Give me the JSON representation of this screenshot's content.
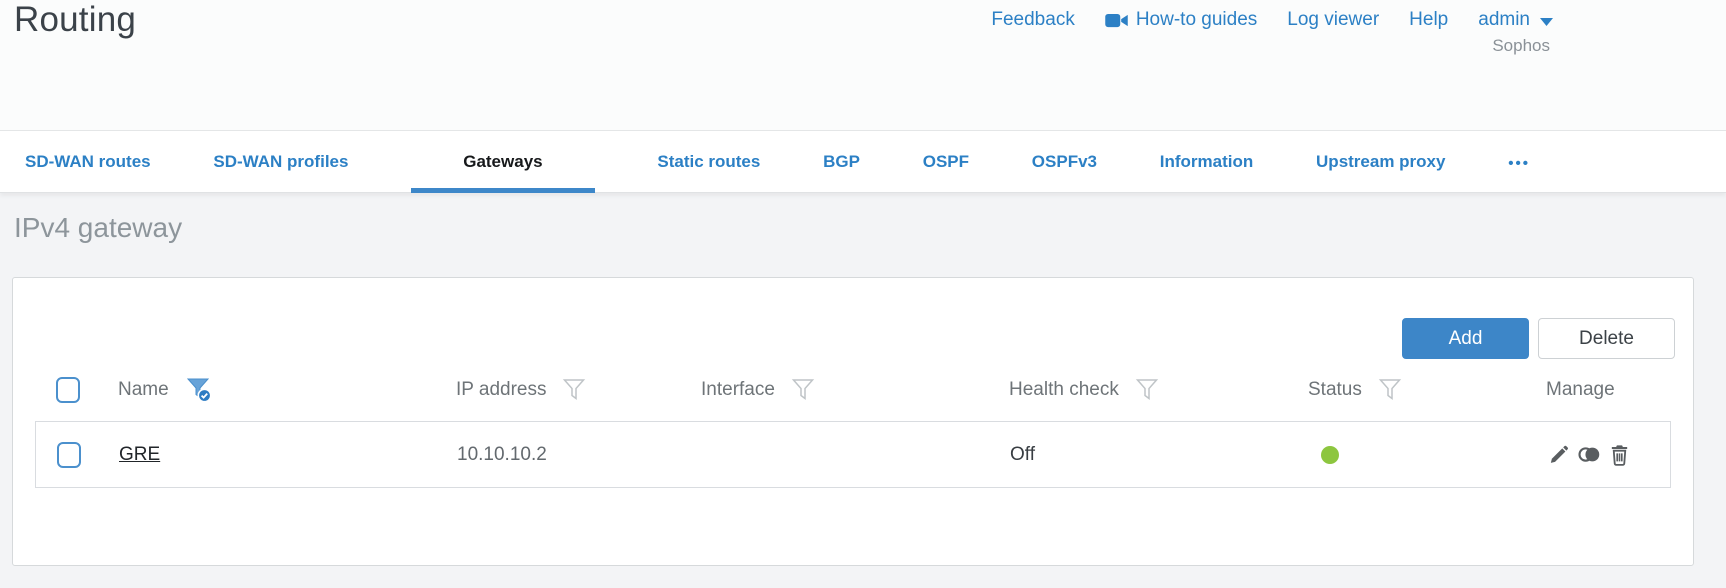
{
  "window": {
    "title": "Routing",
    "brand": "Sophos"
  },
  "header": {
    "links": [
      {
        "label": "Feedback"
      },
      {
        "label": "How-to guides",
        "icon": "video-camera"
      },
      {
        "label": "Log viewer"
      },
      {
        "label": "Help"
      }
    ],
    "user_menu": {
      "label": "admin",
      "icon": "caret-down"
    }
  },
  "tabs": [
    {
      "label": "SD-WAN routes",
      "active": false
    },
    {
      "label": "SD-WAN profiles",
      "active": false
    },
    {
      "label": "Gateways",
      "active": true
    },
    {
      "label": "Static routes",
      "active": false
    },
    {
      "label": "BGP",
      "active": false
    },
    {
      "label": "OSPF",
      "active": false
    },
    {
      "label": "OSPFv3",
      "active": false
    },
    {
      "label": "Information",
      "active": false
    },
    {
      "label": "Upstream proxy",
      "active": false
    }
  ],
  "tabs_overflow": {
    "glyph": "•••",
    "icon": "ellipsis"
  },
  "section": {
    "title": "IPv4 gateway"
  },
  "toolbar": {
    "add": "Add",
    "delete": "Delete"
  },
  "table": {
    "columns": [
      {
        "label": "Name",
        "filter": "active"
      },
      {
        "label": "IP address",
        "filter": "inactive"
      },
      {
        "label": "Interface",
        "filter": "inactive"
      },
      {
        "label": "Health check",
        "filter": "inactive"
      },
      {
        "label": "Status",
        "filter": "inactive"
      },
      {
        "label": "Manage",
        "filter": "none"
      }
    ],
    "rows": [
      {
        "name": "GRE",
        "ip_address": "10.10.10.2",
        "interface": "",
        "health_check": "Off",
        "status": "up",
        "manage": [
          "edit",
          "clone",
          "delete"
        ]
      }
    ]
  },
  "colors": {
    "link_blue": "#2c80c5",
    "button_blue": "#3d86c8",
    "active_tab_underline": "#3d87c9",
    "status_up_green": "#8dc63f"
  }
}
